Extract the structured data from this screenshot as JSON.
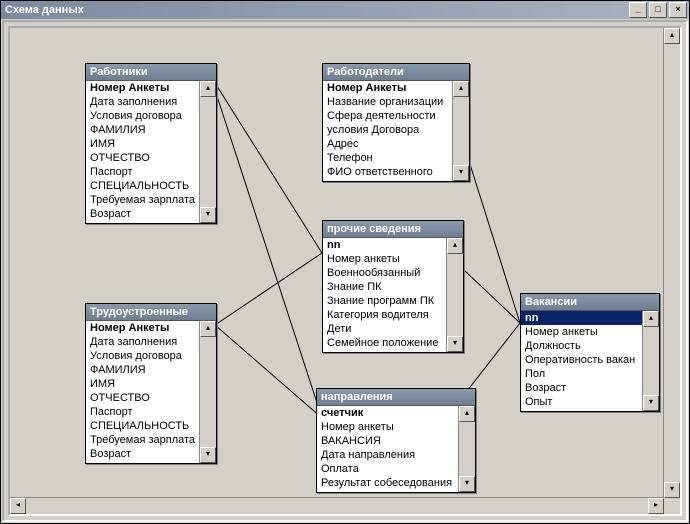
{
  "window": {
    "title": "Схема данных"
  },
  "buttons": {
    "min": "_",
    "max": "□",
    "close": "×"
  },
  "tables": {
    "workers": {
      "title": "Работники",
      "fields": [
        {
          "label": "Номер Анкеты",
          "bold": true
        },
        {
          "label": "Дата заполнения"
        },
        {
          "label": "Условия договора"
        },
        {
          "label": "ФАМИЛИЯ"
        },
        {
          "label": "ИМЯ"
        },
        {
          "label": "ОТЧЕСТВО"
        },
        {
          "label": "Паспорт"
        },
        {
          "label": "СПЕЦИАЛЬНОСТЬ"
        },
        {
          "label": "Требуемая зарплата"
        },
        {
          "label": "Возраст"
        }
      ]
    },
    "employers": {
      "title": "Работодатели",
      "fields": [
        {
          "label": "Номер Анкеты",
          "bold": true
        },
        {
          "label": "Название организации"
        },
        {
          "label": "Сфера деятельности"
        },
        {
          "label": "условия Договора"
        },
        {
          "label": "Адрес"
        },
        {
          "label": "Телефон"
        },
        {
          "label": "ФИО ответственного"
        }
      ]
    },
    "other": {
      "title": "прочие сведения",
      "fields": [
        {
          "label": "nn",
          "bold": true
        },
        {
          "label": "Номер анкеты"
        },
        {
          "label": "Военнообязанный"
        },
        {
          "label": "Знание ПК"
        },
        {
          "label": "Знание программ ПК"
        },
        {
          "label": "Категория водителя"
        },
        {
          "label": "Дети"
        },
        {
          "label": "Семейное положение"
        }
      ]
    },
    "employed": {
      "title": "Трудоустроенные",
      "fields": [
        {
          "label": "Номер Анкеты",
          "bold": true
        },
        {
          "label": "Дата заполнения"
        },
        {
          "label": "Условия договора"
        },
        {
          "label": "ФАМИЛИЯ"
        },
        {
          "label": "ИМЯ"
        },
        {
          "label": "ОТЧЕСТВО"
        },
        {
          "label": "Паспорт"
        },
        {
          "label": "СПЕЦИАЛЬНОСТЬ"
        },
        {
          "label": "Требуемая зарплата"
        },
        {
          "label": "Возраст"
        }
      ]
    },
    "directions": {
      "title": "направления",
      "fields": [
        {
          "label": "счетчик",
          "bold": true
        },
        {
          "label": "Номер анкеты"
        },
        {
          "label": "ВАКАНСИЯ"
        },
        {
          "label": "Дата направления"
        },
        {
          "label": "Оплата"
        },
        {
          "label": "Результат собеседования"
        }
      ]
    },
    "vacancies": {
      "title": "Вакансии",
      "fields": [
        {
          "label": "nn",
          "bold": true,
          "selected": true
        },
        {
          "label": "Номер анкеты"
        },
        {
          "label": "Должность"
        },
        {
          "label": "Оперативность вакан"
        },
        {
          "label": "Пол"
        },
        {
          "label": "Возраст"
        },
        {
          "label": "Опыт"
        }
      ]
    }
  }
}
